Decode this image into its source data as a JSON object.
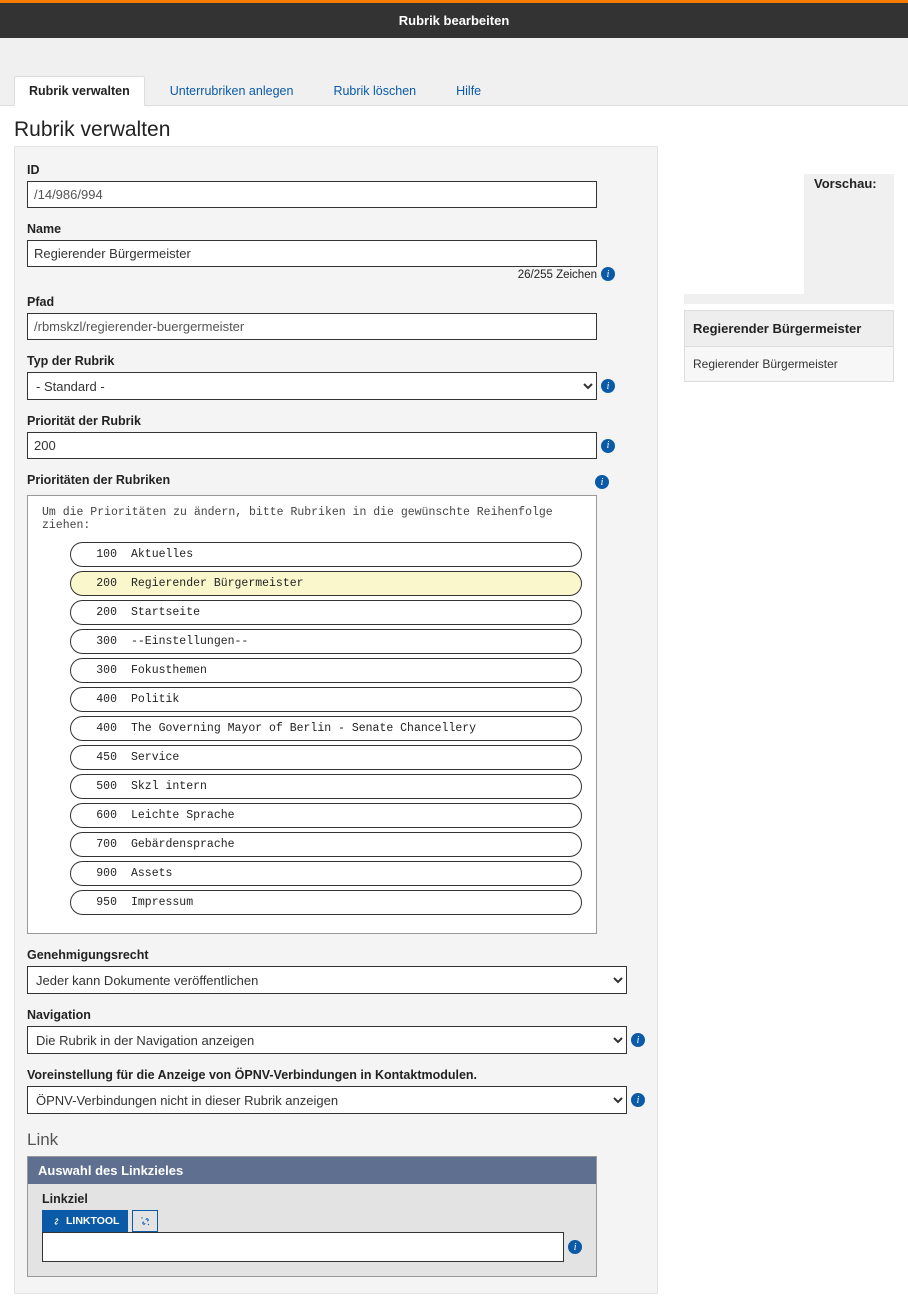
{
  "header": {
    "title": "Rubrik bearbeiten"
  },
  "tabs": [
    {
      "label": "Rubrik verwalten",
      "active": true
    },
    {
      "label": "Unterrubriken anlegen",
      "active": false
    },
    {
      "label": "Rubrik löschen",
      "active": false
    },
    {
      "label": "Hilfe",
      "active": false
    }
  ],
  "page_title": "Rubrik verwalten",
  "fields": {
    "id": {
      "label": "ID",
      "value": "/14/986/994"
    },
    "name": {
      "label": "Name",
      "value": "Regierender Bürgermeister",
      "count": "26/255 Zeichen"
    },
    "path": {
      "label": "Pfad",
      "value": "/rbmskzl/regierender-buergermeister"
    },
    "type": {
      "label": "Typ der Rubrik",
      "value": "- Standard -"
    },
    "priority": {
      "label": "Priorität der Rubrik",
      "value": "200"
    },
    "prio_list": {
      "label": "Prioritäten der Rubriken",
      "hint": "Um die Prioritäten zu ändern, bitte Rubriken in die gewünschte Reihenfolge ziehen:",
      "items": [
        {
          "num": "100",
          "name": "Aktuelles",
          "hl": false
        },
        {
          "num": "200",
          "name": "Regierender Bürgermeister",
          "hl": true
        },
        {
          "num": "200",
          "name": "Startseite",
          "hl": false
        },
        {
          "num": "300",
          "name": "--Einstellungen--",
          "hl": false
        },
        {
          "num": "300",
          "name": "Fokusthemen",
          "hl": false
        },
        {
          "num": "400",
          "name": "Politik",
          "hl": false
        },
        {
          "num": "400",
          "name": "The Governing Mayor of Berlin - Senate Chancellery",
          "hl": false
        },
        {
          "num": "450",
          "name": "Service",
          "hl": false
        },
        {
          "num": "500",
          "name": "Skzl intern",
          "hl": false
        },
        {
          "num": "600",
          "name": "Leichte Sprache",
          "hl": false
        },
        {
          "num": "700",
          "name": "Gebärdensprache",
          "hl": false
        },
        {
          "num": "900",
          "name": "Assets",
          "hl": false
        },
        {
          "num": "950",
          "name": "Impressum",
          "hl": false
        }
      ]
    },
    "approval": {
      "label": "Genehmigungsrecht",
      "value": "Jeder kann Dokumente veröffentlichen"
    },
    "navigation": {
      "label": "Navigation",
      "value": "Die Rubrik in der Navigation anzeigen"
    },
    "opnv": {
      "label": "Voreinstellung für die Anzeige von ÖPNV-Verbindungen in Kontaktmodulen.",
      "value": "ÖPNV-Verbindungen nicht in dieser Rubrik anzeigen"
    },
    "link": {
      "title": "Link",
      "panel_title": "Auswahl des Linkzieles",
      "target_label": "Linkziel",
      "tool_label": "LINKTOOL",
      "value": ""
    }
  },
  "preview": {
    "label": "Vorschau:",
    "title": "Regierender Bürgermeister",
    "sub": "Regierender Bürgermeister"
  },
  "info_glyph": "i"
}
